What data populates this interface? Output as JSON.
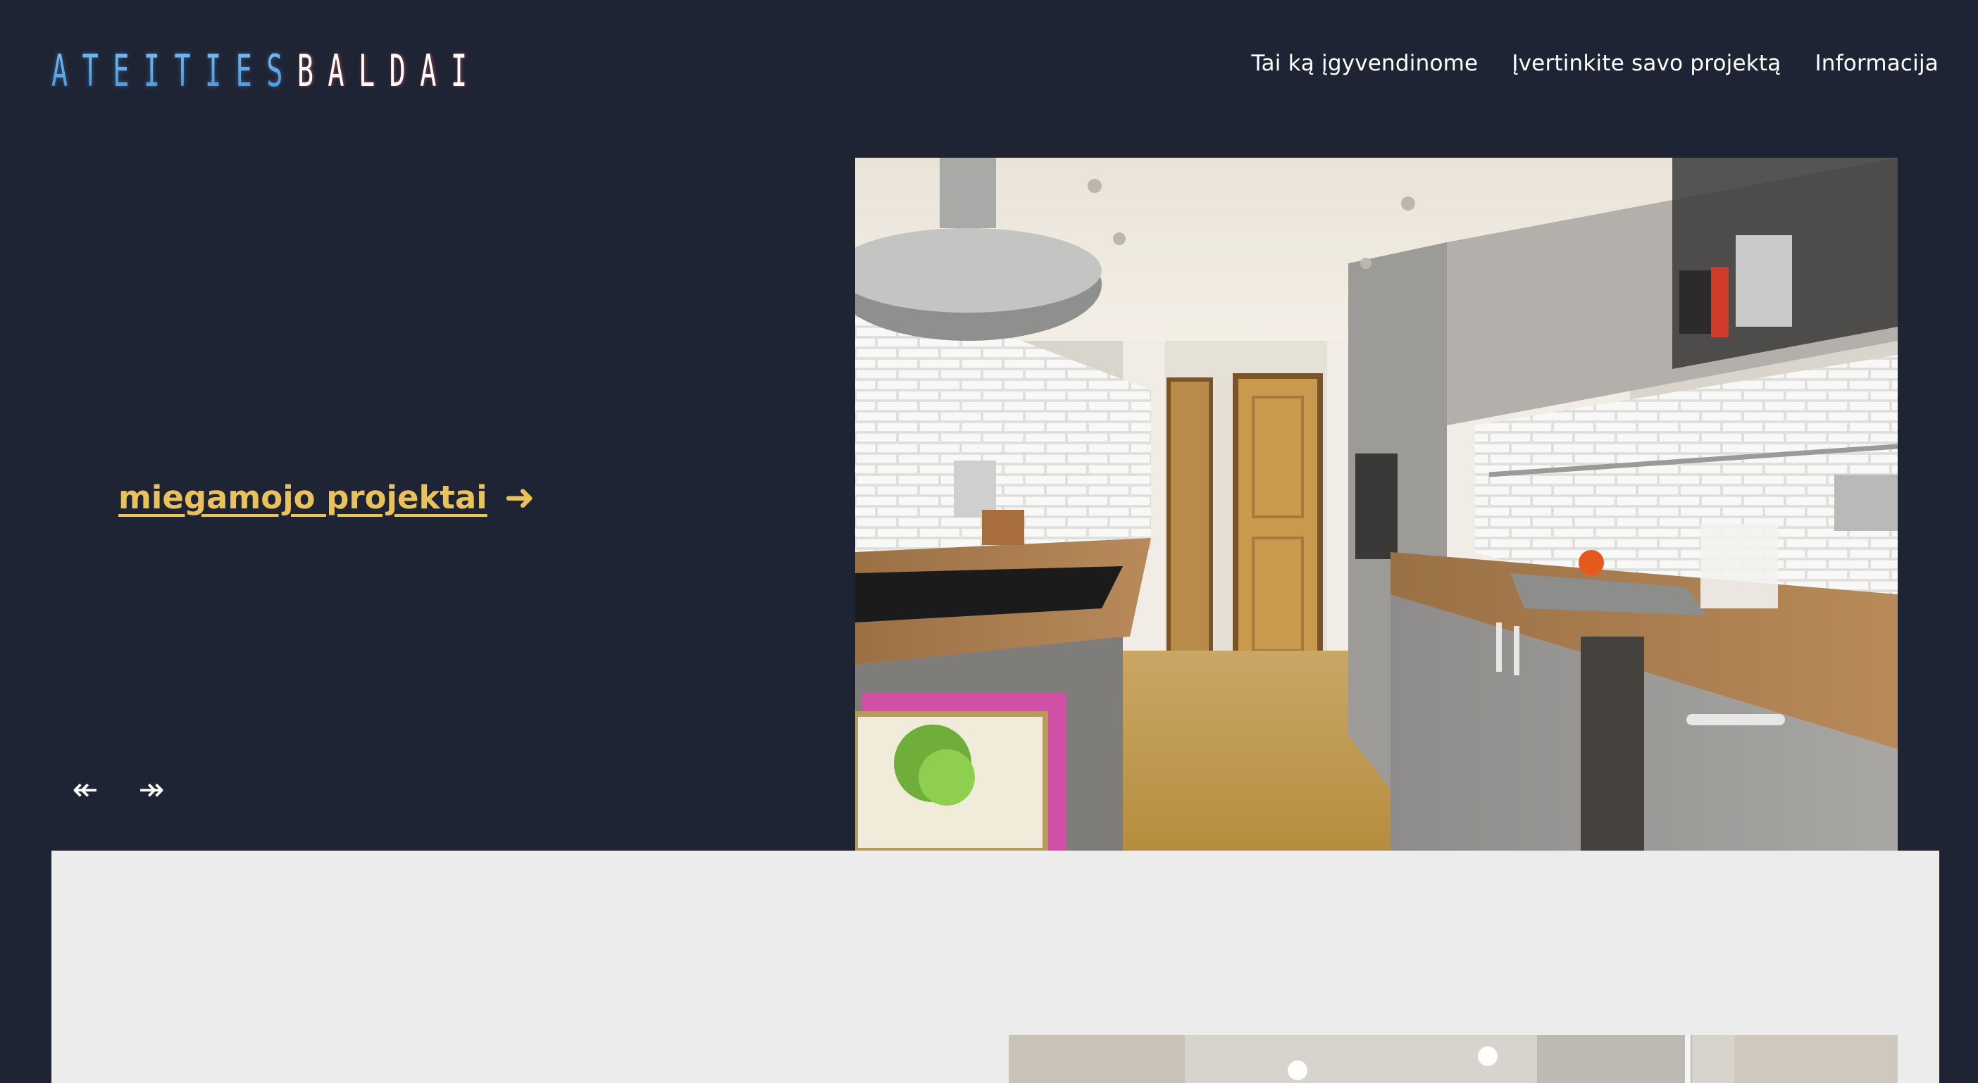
{
  "header": {
    "logo_part1": "ATEITIES",
    "logo_part2": "BALDAI",
    "nav": [
      {
        "label": "Tai ką įgyvendinome"
      },
      {
        "label": "Įvertinkite savo projektą"
      },
      {
        "label": "Informacija"
      }
    ]
  },
  "hero": {
    "link_label": "miegamojo projektai",
    "link_arrow": "➜",
    "prev_arrow": "↞",
    "next_arrow": "↠",
    "image_subject": "kitchen-photo"
  },
  "lower": {
    "image_subject": "interior-photo"
  },
  "colors": {
    "background": "#1f2434",
    "accent": "#e9c35a",
    "logo_blue": "#5aaae8",
    "lower_bg": "#ececec"
  }
}
